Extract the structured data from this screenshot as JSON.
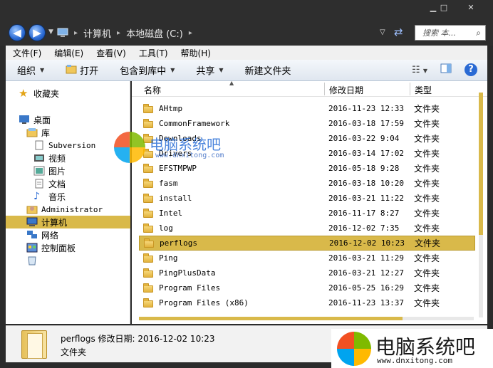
{
  "window": {
    "minimize": "▁",
    "maximize": "□",
    "close": "✕"
  },
  "address": {
    "crumbs": [
      "计算机",
      "本地磁盘 (C:)"
    ],
    "separator": "▸"
  },
  "search": {
    "placeholder": "搜索 本..."
  },
  "menu": [
    "文件(F)",
    "编辑(E)",
    "查看(V)",
    "工具(T)",
    "帮助(H)"
  ],
  "toolbar": {
    "organize": "组织",
    "open": "打开",
    "include": "包含到库中",
    "share": "共享",
    "new_folder": "新建文件夹",
    "help": "?"
  },
  "nav": {
    "favorites": "收藏夹",
    "desktop": "桌面",
    "libraries": "库",
    "subversion": "Subversion",
    "videos": "视频",
    "pictures": "图片",
    "documents": "文档",
    "music": "音乐",
    "administrator": "Administrator",
    "computer": "计算机",
    "network": "网络",
    "control_panel": "控制面板"
  },
  "columns": {
    "name": "名称",
    "date": "修改日期",
    "type": "类型"
  },
  "files": [
    {
      "name": "AHtmp",
      "date": "2016-11-23 12:33",
      "type": "文件夹"
    },
    {
      "name": "CommonFramework",
      "date": "2016-03-18 17:59",
      "type": "文件夹"
    },
    {
      "name": "Downloads",
      "date": "2016-03-22 9:04",
      "type": "文件夹"
    },
    {
      "name": "Drivers",
      "date": "2016-03-14 17:02",
      "type": "文件夹"
    },
    {
      "name": "EFSTMPWP",
      "date": "2016-05-18 9:28",
      "type": "文件夹"
    },
    {
      "name": "fasm",
      "date": "2016-03-18 10:20",
      "type": "文件夹"
    },
    {
      "name": "install",
      "date": "2016-03-21 11:22",
      "type": "文件夹"
    },
    {
      "name": "Intel",
      "date": "2016-11-17 8:27",
      "type": "文件夹"
    },
    {
      "name": "log",
      "date": "2016-12-02 7:35",
      "type": "文件夹"
    },
    {
      "name": "perflogs",
      "date": "2016-12-02 10:23",
      "type": "文件夹"
    },
    {
      "name": "Ping",
      "date": "2016-03-21 11:29",
      "type": "文件夹"
    },
    {
      "name": "PingPlusData",
      "date": "2016-03-21 12:27",
      "type": "文件夹"
    },
    {
      "name": "Program Files",
      "date": "2016-05-25 16:29",
      "type": "文件夹"
    },
    {
      "name": "Program Files (x86)",
      "date": "2016-11-23 13:37",
      "type": "文件夹"
    }
  ],
  "selected_index": 9,
  "details": {
    "line1": "perflogs 修改日期: 2016-12-02 10:23",
    "line2": "文件夹"
  },
  "watermark": {
    "center_title": "电脑系统吧",
    "center_url": "www.dnxitong.com",
    "corner_title": "电脑系统吧",
    "corner_url": "www.dnxitong.com"
  },
  "colors": {
    "selection": "#d9b94a",
    "titlebar": "#2e2e2e",
    "accent_blue": "#2a6ad4"
  }
}
